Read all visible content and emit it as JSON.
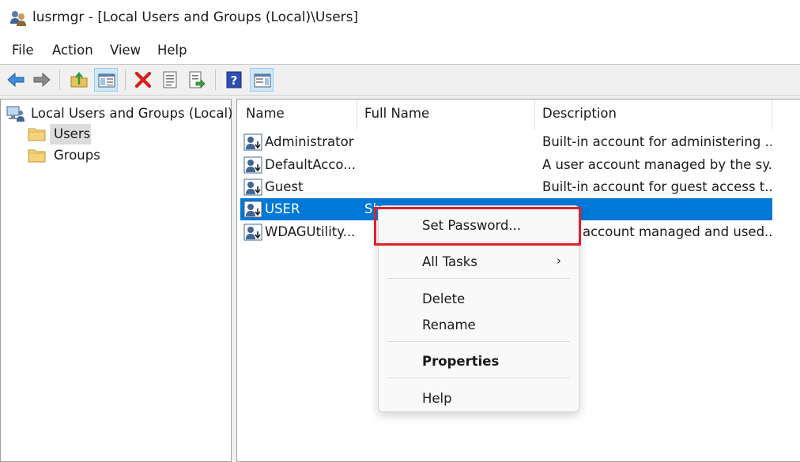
{
  "window": {
    "title": "lusrmgr - [Local Users and Groups (Local)\\Users]"
  },
  "menubar": {
    "items": [
      {
        "label": "File"
      },
      {
        "label": "Action"
      },
      {
        "label": "View"
      },
      {
        "label": "Help"
      }
    ]
  },
  "toolbar": {
    "buttons": [
      {
        "icon": "back-arrow-icon"
      },
      {
        "icon": "forward-arrow-icon"
      },
      {
        "icon": "up-folder-icon"
      },
      {
        "icon": "show-hide-tree-icon",
        "pressed": true
      },
      {
        "icon": "delete-icon"
      },
      {
        "icon": "properties-icon"
      },
      {
        "icon": "export-list-icon"
      },
      {
        "icon": "help-icon"
      },
      {
        "icon": "show-hide-action-pane-icon",
        "pressed": true
      }
    ]
  },
  "tree": {
    "root": {
      "label": "Local Users and Groups (Local)",
      "icon": "computer-users-icon"
    },
    "children": [
      {
        "label": "Users",
        "icon": "folder-icon",
        "selected": true
      },
      {
        "label": "Groups",
        "icon": "folder-icon",
        "selected": false
      }
    ]
  },
  "list": {
    "columns": [
      {
        "label": "Name"
      },
      {
        "label": "Full Name"
      },
      {
        "label": "Description"
      }
    ],
    "rows": [
      {
        "name": "Administrator",
        "full_name": "",
        "description": "Built-in account for administering ...",
        "selected": false
      },
      {
        "name": "DefaultAcco...",
        "full_name": "",
        "description": "A user account managed by the sy...",
        "selected": false
      },
      {
        "name": "Guest",
        "full_name": "",
        "description": "Built-in account for guest access t...",
        "selected": false
      },
      {
        "name": "USER",
        "full_name": "Sh",
        "description": "",
        "selected": true
      },
      {
        "name": "WDAGUtility...",
        "full_name": "",
        "description": "account managed and used...",
        "selected": false
      }
    ]
  },
  "context_menu": {
    "items": [
      {
        "label": "Set Password...",
        "bold": false,
        "submenu": false,
        "highlighted": true
      },
      {
        "label": "All Tasks",
        "bold": false,
        "submenu": true,
        "arrow": "›"
      },
      {
        "label": "Delete",
        "bold": false,
        "submenu": false
      },
      {
        "label": "Rename",
        "bold": false,
        "submenu": false
      },
      {
        "label": "Properties",
        "bold": true,
        "submenu": false
      },
      {
        "label": "Help",
        "bold": false,
        "submenu": false
      }
    ]
  },
  "colors": {
    "selection": "#0078d7",
    "highlight_border": "#e0202a",
    "delete_red": "#d81e1e"
  }
}
